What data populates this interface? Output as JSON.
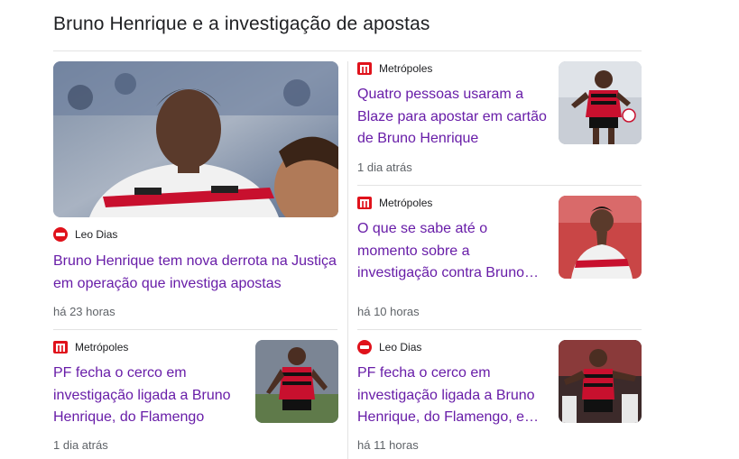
{
  "heading": "Bruno Henrique e a investigação de apostas",
  "articles": [
    {
      "source": "Leo Dias",
      "source_logo": "leo-dias-logo",
      "title": "Bruno Henrique tem nova derrota na Justiça em operação que investiga apostas",
      "time": "há 23 horas",
      "image": "bruno-henrique-flamengo-jersey-photo"
    },
    {
      "source": "Metrópoles",
      "source_logo": "metropoles-logo",
      "title": "Quatro pessoas usaram a Blaze para apostar em cartão de Bruno Henrique",
      "time": "1 dia atrás",
      "image": "bruno-henrique-running-photo"
    },
    {
      "source": "Metrópoles",
      "source_logo": "metropoles-logo",
      "title": "O que se sabe até o momento sobre a investigação contra Bruno Henrique",
      "time": "há 10 horas",
      "image": "bruno-henrique-hands-together-photo"
    },
    {
      "source": "Metrópoles",
      "source_logo": "metropoles-logo",
      "title": "PF fecha o cerco em investigação ligada a Bruno Henrique, do Flamengo",
      "time": "1 dia atrás",
      "image": "bruno-henrique-dribbling-photo"
    },
    {
      "source": "Leo Dias",
      "source_logo": "leo-dias-logo",
      "title": "PF fecha o cerco em investigação ligada a Bruno Henrique, do Flamengo, e cumpre mandados",
      "time": "há 11 horas",
      "image": "bruno-henrique-celebrating-photo"
    }
  ],
  "colors": {
    "title_link": "#681da8",
    "leo_dias_brand": "#e0121b",
    "metropoles_brand": "#e0121b",
    "flamengo_red": "#c8102e"
  }
}
